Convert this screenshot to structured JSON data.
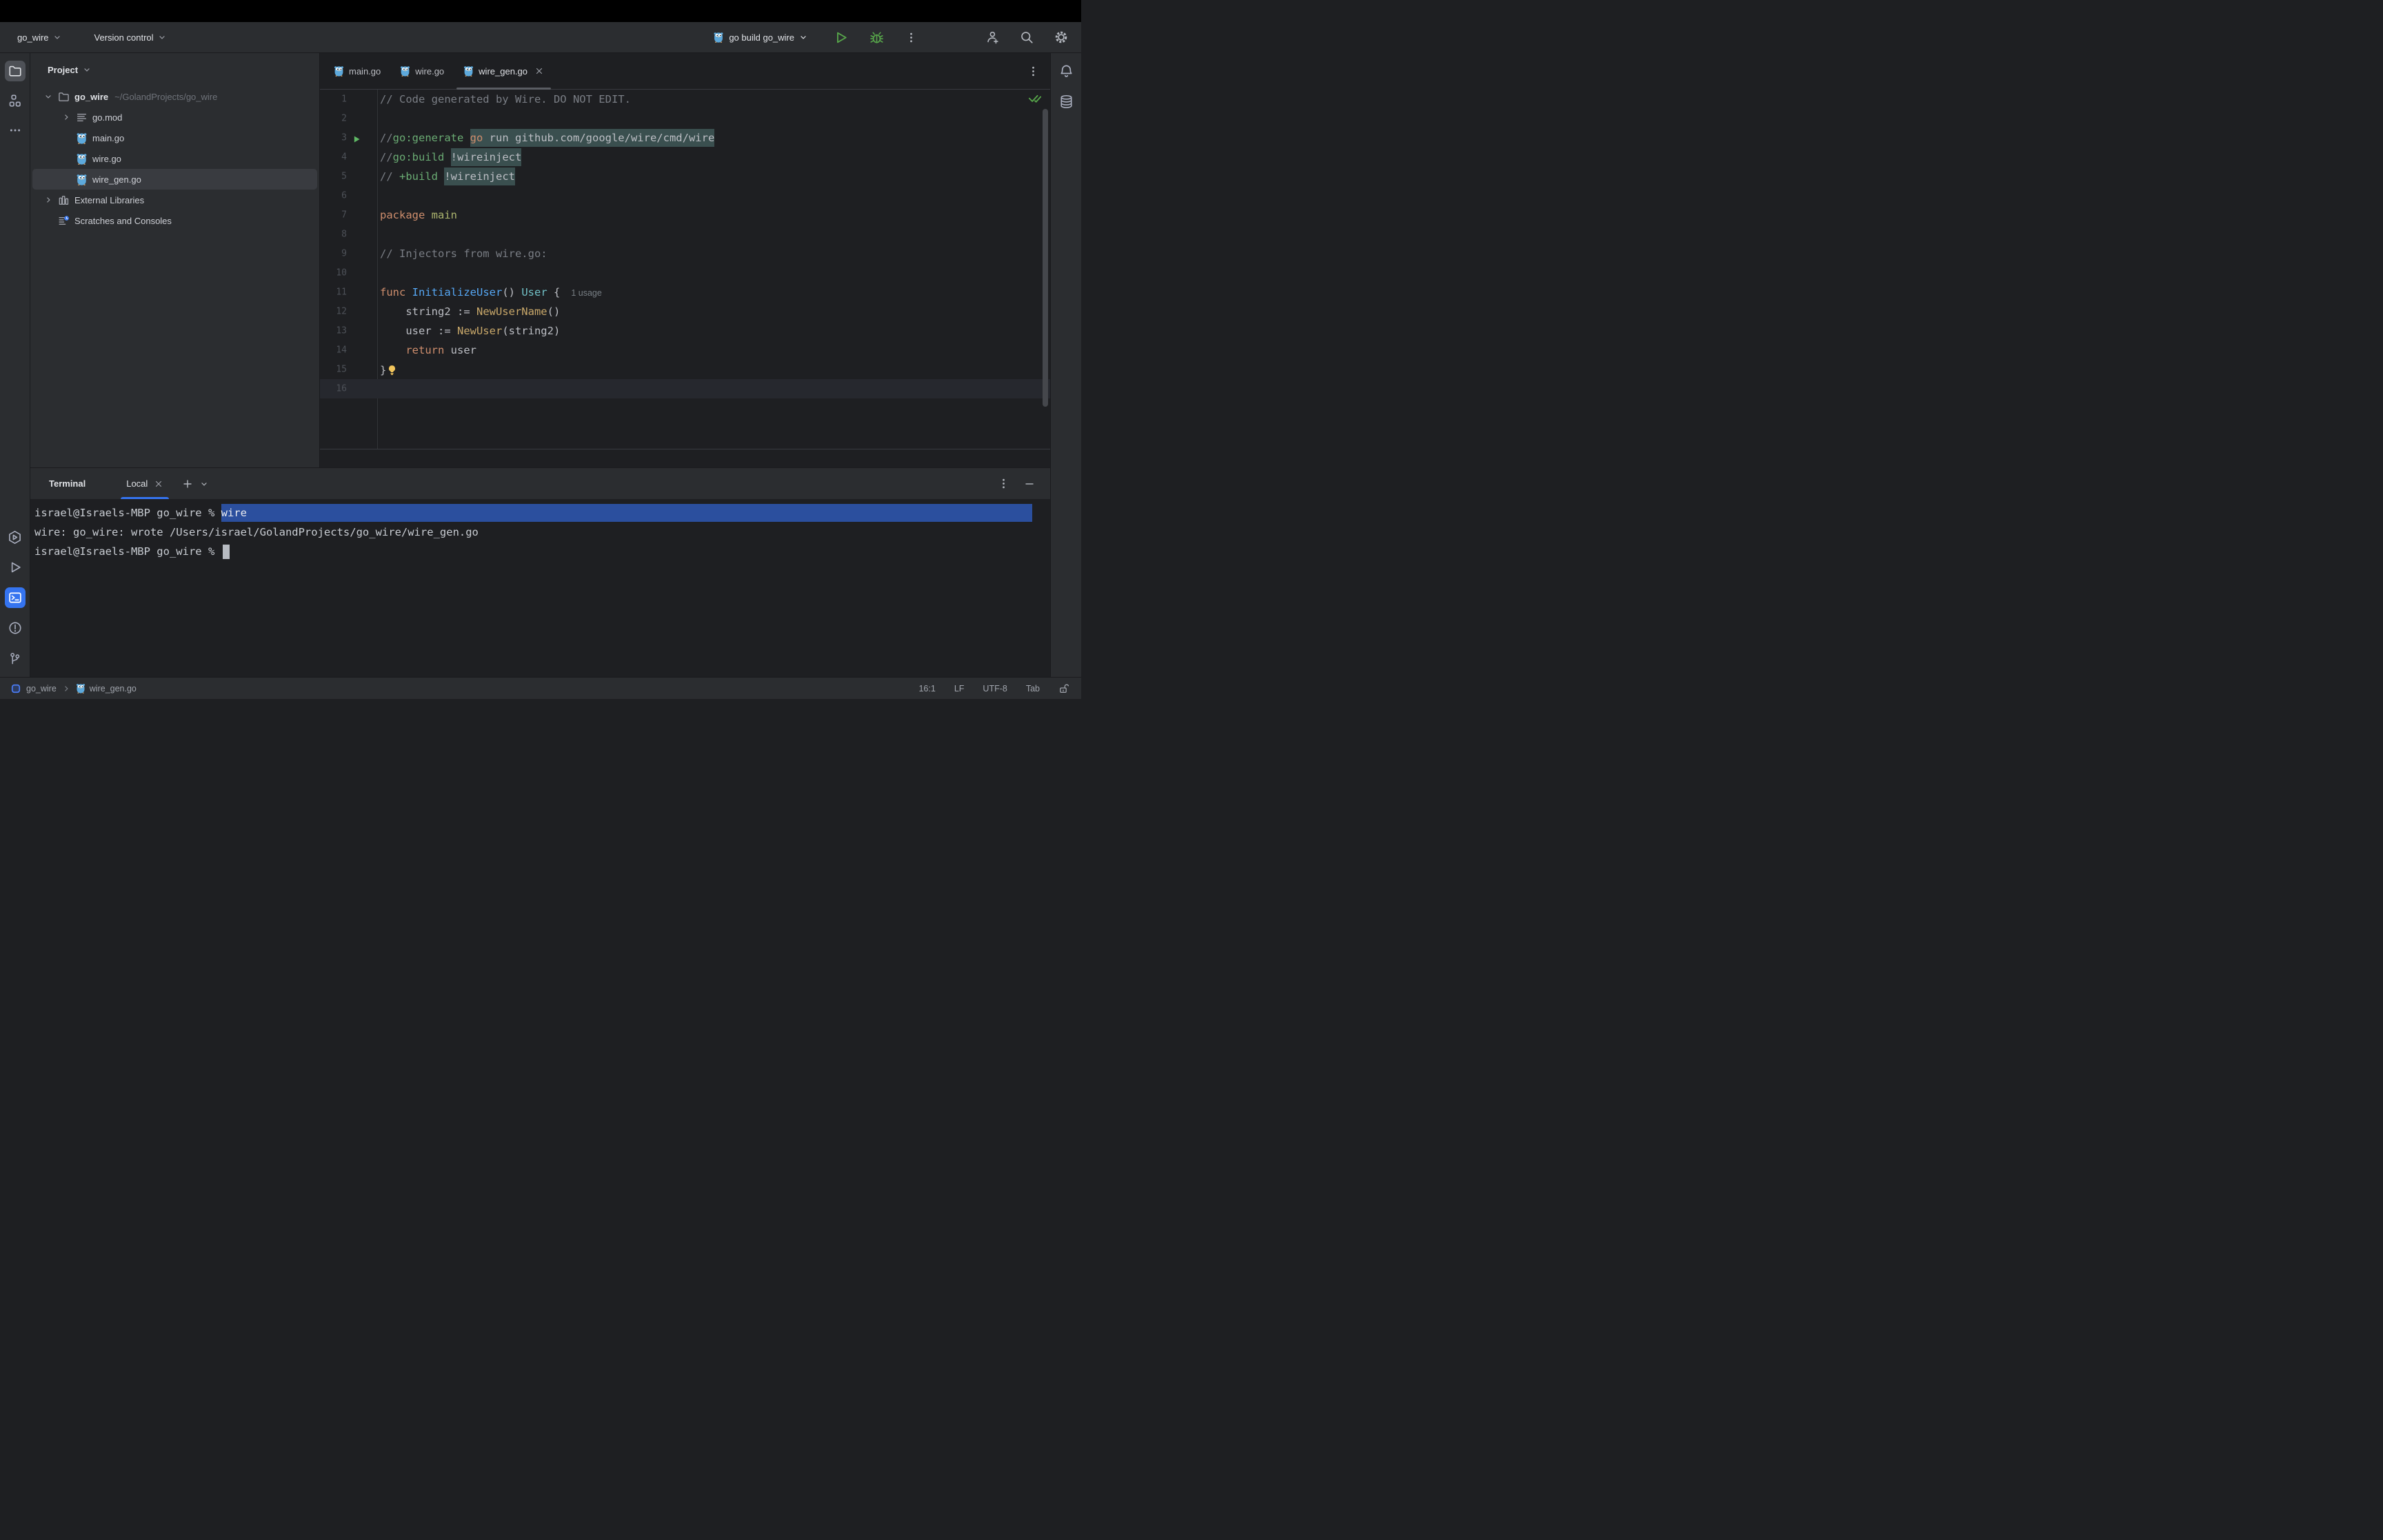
{
  "toolbar": {
    "project_button": "go_wire",
    "vcs_button": "Version control",
    "run_config": "go build go_wire",
    "right_icons": [
      "run",
      "debug",
      "more"
    ],
    "far_icons": [
      "add-user",
      "search-everywhere",
      "settings"
    ]
  },
  "activity_bar": {
    "top": [
      {
        "icon": "project-folder",
        "active": true
      },
      {
        "icon": "structure",
        "active": false
      },
      {
        "icon": "more",
        "active": false
      }
    ],
    "bottom": [
      {
        "icon": "services",
        "active": false
      },
      {
        "icon": "run",
        "active": false
      },
      {
        "icon": "terminal",
        "active": true
      },
      {
        "icon": "problems",
        "active": false
      },
      {
        "icon": "git-branch",
        "active": false
      }
    ]
  },
  "right_rail": [
    "notifications",
    "database"
  ],
  "project_panel": {
    "title": "Project",
    "tree": [
      {
        "label": "go_wire",
        "path": "~/GolandProjects/go_wire",
        "icon": "folder",
        "depth": 0,
        "chevron": "down",
        "bold": true
      },
      {
        "label": "go.mod",
        "icon": "gomod",
        "depth": 1,
        "chevron": "right"
      },
      {
        "label": "main.go",
        "icon": "gopher",
        "depth": 1
      },
      {
        "label": "wire.go",
        "icon": "gopher",
        "depth": 1
      },
      {
        "label": "wire_gen.go",
        "icon": "gopher",
        "depth": 1,
        "selected": true
      },
      {
        "label": "External Libraries",
        "icon": "library",
        "depth": 0,
        "chevron": "right"
      },
      {
        "label": "Scratches and Consoles",
        "icon": "scratch",
        "depth": 0
      }
    ]
  },
  "editor": {
    "tabs": [
      {
        "label": "main.go"
      },
      {
        "label": "wire.go"
      },
      {
        "label": "wire_gen.go",
        "active": true
      }
    ],
    "lines": [
      {
        "n": 1,
        "tokens": [
          {
            "t": "// Code generated by Wire. DO NOT EDIT.",
            "c": "cmt"
          }
        ]
      },
      {
        "n": 2,
        "tokens": []
      },
      {
        "n": 3,
        "run": true,
        "tokens": [
          {
            "t": "//",
            "c": "cmt"
          },
          {
            "t": "go:generate",
            "c": "dir"
          },
          {
            "t": " ",
            "c": "txt"
          },
          {
            "t": "go",
            "c": "kw",
            "h": true
          },
          {
            "t": " run github.com/google/wire/cmd/wire",
            "c": "txt",
            "h": true
          }
        ]
      },
      {
        "n": 4,
        "tokens": [
          {
            "t": "//",
            "c": "cmt"
          },
          {
            "t": "go:build",
            "c": "dir"
          },
          {
            "t": " ",
            "c": "txt"
          },
          {
            "t": "!wireinject",
            "c": "txt",
            "h": true
          }
        ]
      },
      {
        "n": 5,
        "tokens": [
          {
            "t": "// ",
            "c": "cmt"
          },
          {
            "t": "+build",
            "c": "dir"
          },
          {
            "t": " ",
            "c": "txt"
          },
          {
            "t": "!wireinject",
            "c": "txt",
            "h": true
          }
        ]
      },
      {
        "n": 6,
        "tokens": []
      },
      {
        "n": 7,
        "tokens": [
          {
            "t": "package",
            "c": "kw"
          },
          {
            "t": " ",
            "c": "txt"
          },
          {
            "t": "main",
            "c": "pkg"
          }
        ]
      },
      {
        "n": 8,
        "tokens": []
      },
      {
        "n": 9,
        "tokens": [
          {
            "t": "// Injectors from wire.go:",
            "c": "cmt"
          }
        ]
      },
      {
        "n": 10,
        "tokens": []
      },
      {
        "n": 11,
        "inlay": "1 usage",
        "tokens": [
          {
            "t": "func",
            "c": "kw"
          },
          {
            "t": " ",
            "c": "txt"
          },
          {
            "t": "InitializeUser",
            "c": "fn"
          },
          {
            "t": "() ",
            "c": "txt"
          },
          {
            "t": "User",
            "c": "typ"
          },
          {
            "t": " {",
            "c": "txt"
          }
        ]
      },
      {
        "n": 12,
        "tokens": [
          {
            "t": "    string2 := ",
            "c": "txt"
          },
          {
            "t": "NewUserName",
            "c": "call"
          },
          {
            "t": "()",
            "c": "txt"
          }
        ]
      },
      {
        "n": 13,
        "tokens": [
          {
            "t": "    user := ",
            "c": "txt"
          },
          {
            "t": "NewUser",
            "c": "call"
          },
          {
            "t": "(string2)",
            "c": "txt"
          }
        ]
      },
      {
        "n": 14,
        "tokens": [
          {
            "t": "    ",
            "c": "txt"
          },
          {
            "t": "return",
            "c": "kw"
          },
          {
            "t": " user",
            "c": "txt"
          }
        ]
      },
      {
        "n": 15,
        "bulb": true,
        "tokens": [
          {
            "t": "}",
            "c": "txt"
          }
        ]
      },
      {
        "n": 16,
        "caret": true,
        "tokens": []
      }
    ]
  },
  "terminal": {
    "title": "Terminal",
    "tab": "Local",
    "lines": [
      {
        "prompt": "israel@Israels-MBP go_wire % ",
        "command": "wire",
        "selected": true
      },
      {
        "text": "wire: go_wire: wrote /Users/israel/GolandProjects/go_wire/wire_gen.go"
      },
      {
        "prompt": "israel@Israels-MBP go_wire % ",
        "cursor": true
      }
    ]
  },
  "status_bar": {
    "project": "go_wire",
    "file": "wire_gen.go",
    "caret": "16:1",
    "line_separator": "LF",
    "encoding": "UTF-8",
    "indent": "Tab"
  },
  "colors": {
    "accent_blue": "#3574f0",
    "selection_blue": "#2b4f9e",
    "highlight_teal": "#3a4f4f",
    "run_green": "#57a64a"
  }
}
